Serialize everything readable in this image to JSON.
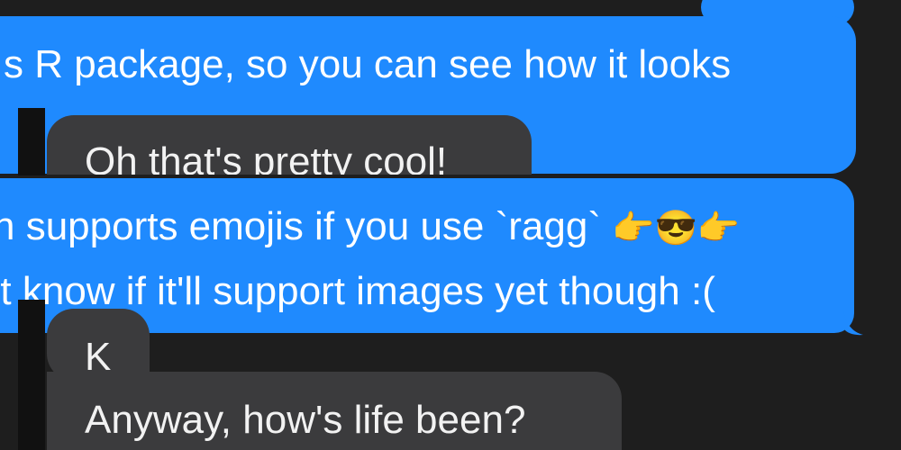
{
  "conversation": {
    "messages": [
      {
        "id": "sent-1",
        "direction": "sent",
        "text": "s R package, so you can see how it looks"
      },
      {
        "id": "recv-1",
        "direction": "received",
        "text": "Oh that's pretty cool!"
      },
      {
        "id": "sent-2-line-1",
        "direction": "sent",
        "text": "n supports emojis if you use `ragg`",
        "emojis": [
          "👉",
          "😎",
          "👉"
        ]
      },
      {
        "id": "sent-2-line-2",
        "direction": "sent",
        "text": "'t know if it'll support images yet though :("
      },
      {
        "id": "recv-2",
        "direction": "received",
        "text": "K"
      },
      {
        "id": "recv-3",
        "direction": "received",
        "text": "Anyway, how's life been?"
      }
    ]
  },
  "colors": {
    "background": "#1e1e1e",
    "sent_bubble": "#1f8afe",
    "received_bubble": "#3b3b3d",
    "text_light": "#ffffff"
  }
}
